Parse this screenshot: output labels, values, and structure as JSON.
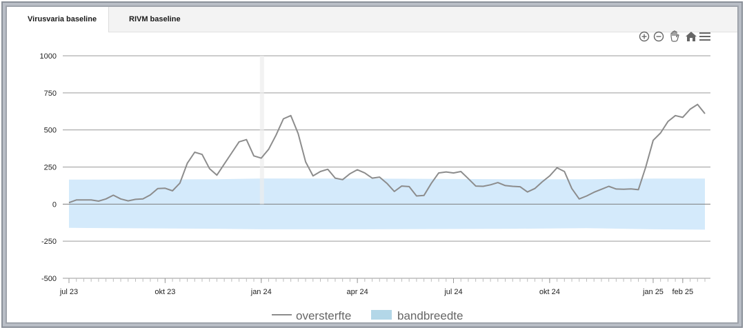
{
  "tabs": [
    {
      "label": "Virusvaria baseline",
      "active": true
    },
    {
      "label": "RIVM baseline",
      "active": false
    }
  ],
  "toolbar": {
    "icons": [
      "zoom-in-icon",
      "zoom-out-icon",
      "pan-hand-icon",
      "home-icon",
      "menu-icon"
    ]
  },
  "colors": {
    "line": "#8c8c8c",
    "band": "#d4eafb",
    "band_legend": "#b3d7e8",
    "grid": "#9a9a9a",
    "zero": "#7c7c7c"
  },
  "chart_data": {
    "type": "line",
    "ylim": [
      -500,
      1000
    ],
    "yticks": [
      1000,
      750,
      500,
      250,
      0,
      -250,
      -500
    ],
    "xlim": [
      0,
      86
    ],
    "xticks": [
      {
        "x": 0,
        "label": "jul 23"
      },
      {
        "x": 13,
        "label": "okt 23"
      },
      {
        "x": 26,
        "label": "jan 24"
      },
      {
        "x": 39,
        "label": "apr 24"
      },
      {
        "x": 52,
        "label": "jul 24"
      },
      {
        "x": 65,
        "label": "okt 24"
      },
      {
        "x": 79,
        "label": "jan 25"
      },
      {
        "x": 83,
        "label": "feb 25"
      }
    ],
    "series": [
      {
        "name": "oversterfte",
        "x": [
          0,
          1,
          2,
          3,
          4,
          5,
          6,
          7,
          8,
          9,
          10,
          11,
          12,
          13,
          14,
          15,
          16,
          17,
          18,
          19,
          20,
          21,
          22,
          23,
          24,
          25,
          26,
          27,
          28,
          29,
          30,
          31,
          32,
          33,
          34,
          35,
          36,
          37,
          38,
          39,
          40,
          41,
          42,
          43,
          44,
          45,
          46,
          47,
          48,
          49,
          50,
          51,
          52,
          53,
          54,
          55,
          56,
          57,
          58,
          59,
          60,
          61,
          62,
          63,
          64,
          65,
          66,
          67,
          68,
          69,
          70,
          71,
          72,
          73,
          74,
          75,
          76,
          77,
          78,
          79,
          80,
          81,
          82,
          83,
          84,
          85,
          86
        ],
        "values": [
          10,
          28,
          28,
          28,
          20,
          35,
          60,
          35,
          22,
          32,
          35,
          62,
          105,
          107,
          90,
          142,
          275,
          350,
          335,
          240,
          195,
          270,
          345,
          420,
          435,
          325,
          310,
          370,
          465,
          575,
          597,
          475,
          285,
          190,
          220,
          235,
          175,
          165,
          205,
          232,
          210,
          175,
          182,
          140,
          85,
          122,
          118,
          55,
          58,
          140,
          210,
          217,
          210,
          220,
          172,
          122,
          120,
          130,
          145,
          125,
          120,
          117,
          82,
          105,
          150,
          190,
          245,
          220,
          105,
          35,
          55,
          80,
          100,
          120,
          102,
          100,
          103,
          97,
          250,
          430,
          480,
          557,
          597,
          585,
          640,
          672,
          610
        ]
      },
      {
        "name": "bandbreedte",
        "x": [
          0,
          20,
          26,
          40,
          60,
          70,
          79,
          86
        ],
        "upper": [
          165,
          168,
          173,
          172,
          168,
          168,
          172,
          172
        ],
        "lower": [
          -160,
          -166,
          -170,
          -170,
          -166,
          -162,
          -170,
          -172
        ]
      }
    ],
    "legend": {
      "placement": "bottom-center",
      "entries": [
        "oversterfte",
        "bandbreedte"
      ]
    },
    "grid": true
  }
}
